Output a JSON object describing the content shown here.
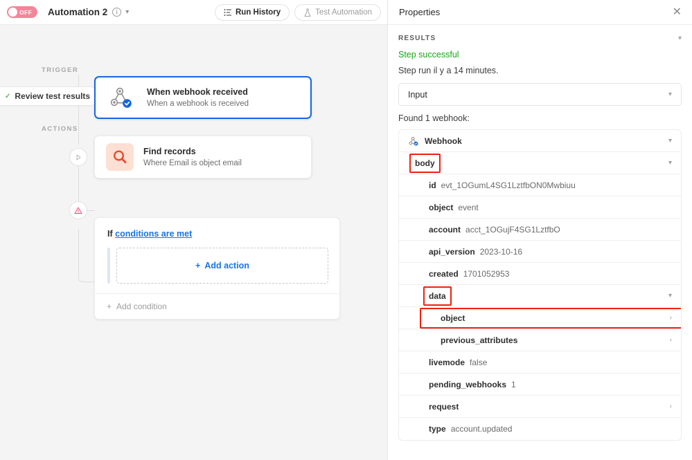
{
  "header": {
    "toggle_label": "OFF",
    "title": "Automation 2",
    "info_icon": "info-icon",
    "caret_icon": "chevron-down-icon",
    "run_history_label": "Run History",
    "test_automation_label": "Test Automation"
  },
  "canvas": {
    "trigger_section_label": "TRIGGER",
    "actions_section_label": "ACTIONS",
    "review_pill_label": "Review test results",
    "trigger_card": {
      "title": "When webhook received",
      "subtitle": "When a webhook is received",
      "icon": "webhook-icon"
    },
    "action_card": {
      "title": "Find records",
      "subtitle": "Where Email is object email",
      "icon": "search-icon"
    },
    "condition_card": {
      "if_label": "If",
      "link_label": "conditions are met",
      "add_action_label": "Add action",
      "add_condition_label": "Add condition"
    }
  },
  "properties": {
    "panel_title": "Properties",
    "close_icon": "close-icon",
    "results_label": "RESULTS",
    "status_text": "Step successful",
    "status_color": "#16a416",
    "run_text": "Step run il y a 14 minutes.",
    "input_select_value": "Input",
    "found_text": "Found 1 webhook:",
    "tree_title": "Webhook",
    "rows": [
      {
        "key": "body",
        "value": "",
        "indent": 1,
        "expand": "chevron-down-icon",
        "highlight": "label"
      },
      {
        "key": "id",
        "value": "evt_1OGumL4SG1LztfbON0Mwbiuu",
        "indent": 2,
        "expand": "",
        "highlight": "none"
      },
      {
        "key": "object",
        "value": "event",
        "indent": 2,
        "expand": "",
        "highlight": "none"
      },
      {
        "key": "account",
        "value": "acct_1OGujF4SG1LztfbO",
        "indent": 2,
        "expand": "",
        "highlight": "none"
      },
      {
        "key": "api_version",
        "value": "2023-10-16",
        "indent": 2,
        "expand": "",
        "highlight": "none"
      },
      {
        "key": "created",
        "value": "1701052953",
        "indent": 2,
        "expand": "",
        "highlight": "none"
      },
      {
        "key": "data",
        "value": "",
        "indent": 2,
        "expand": "chevron-down-icon",
        "highlight": "label"
      },
      {
        "key": "object",
        "value": "",
        "indent": 3,
        "expand": "chevron-right-icon",
        "highlight": "row"
      },
      {
        "key": "previous_attributes",
        "value": "",
        "indent": 3,
        "expand": "chevron-right-icon",
        "highlight": "none"
      },
      {
        "key": "livemode",
        "value": "false",
        "indent": 2,
        "expand": "",
        "highlight": "none"
      },
      {
        "key": "pending_webhooks",
        "value": "1",
        "indent": 2,
        "expand": "",
        "highlight": "none"
      },
      {
        "key": "request",
        "value": "",
        "indent": 2,
        "expand": "chevron-right-icon",
        "highlight": "none"
      },
      {
        "key": "type",
        "value": "account.updated",
        "indent": 2,
        "expand": "",
        "highlight": "none"
      }
    ]
  },
  "colors": {
    "accent_blue": "#1766e0",
    "highlight_red": "#f01f0e",
    "toggle_pink": "#f4869a",
    "success_green": "#16a416"
  }
}
